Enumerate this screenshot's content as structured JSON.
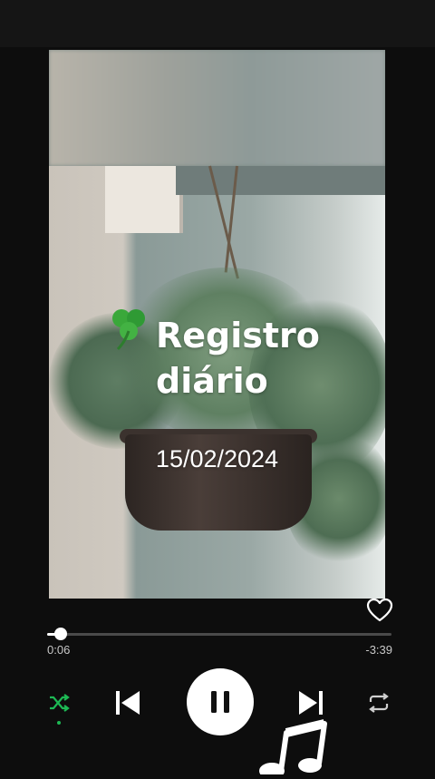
{
  "player": {
    "artwork": {
      "title_line1": "Registro",
      "title_line2": "diário",
      "date": "15/02/2024"
    },
    "progress": {
      "elapsed": "0:06",
      "remaining": "-3:39",
      "fraction": 0.04
    },
    "colors": {
      "accent": "#1db954",
      "background": "#0d0d0d",
      "track": "#4a4a4a"
    },
    "icons": {
      "like": "heart-outline-icon",
      "shuffle": "shuffle-icon",
      "previous": "skip-previous-icon",
      "pause": "pause-icon",
      "next": "skip-next-icon",
      "repeat": "repeat-icon",
      "sticker": "music-note-icon"
    }
  }
}
